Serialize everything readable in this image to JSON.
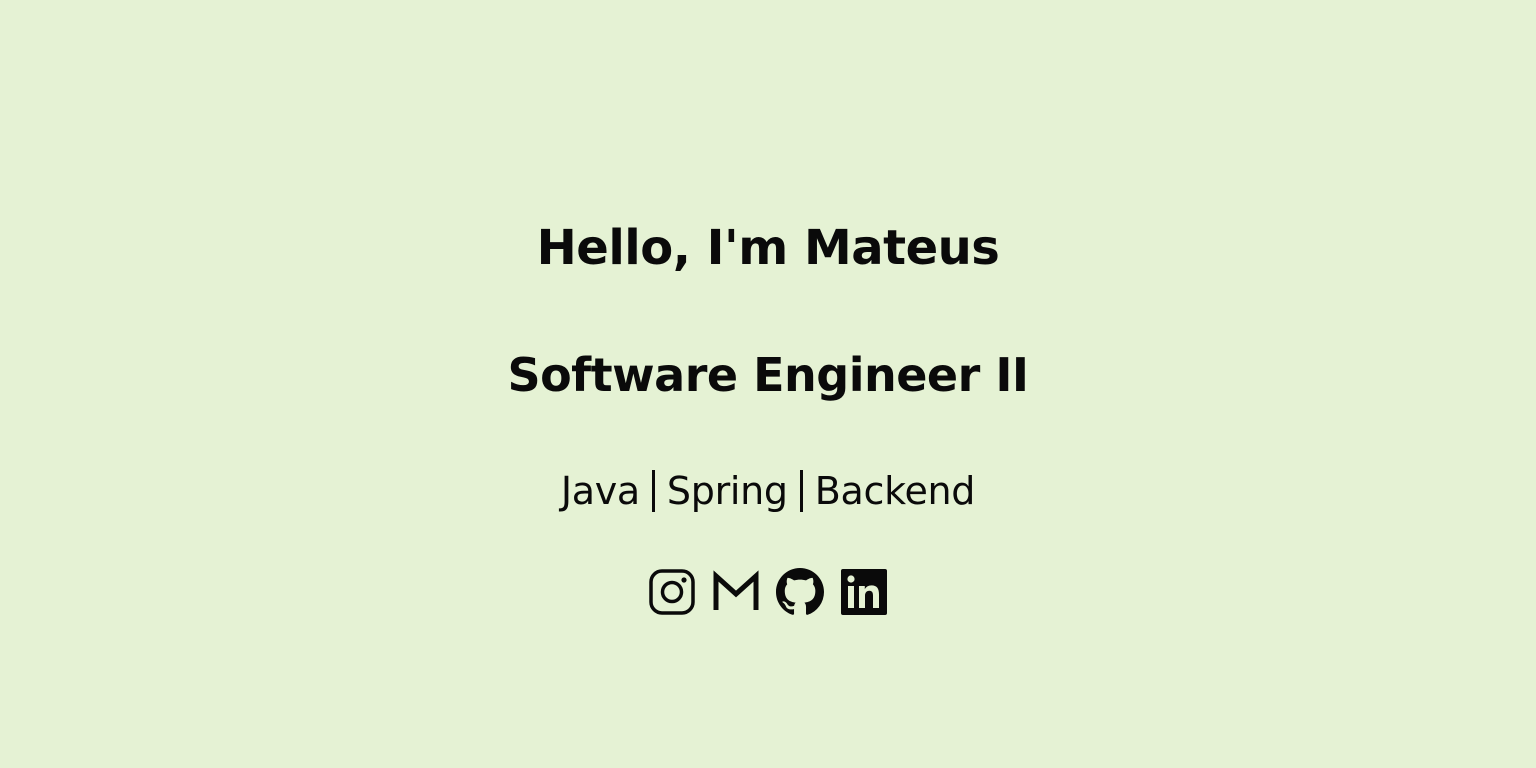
{
  "hero": {
    "title": "Hello, I'm Mateus",
    "subtitle": "Software Engineer II",
    "skills": [
      "Java",
      "Spring",
      "Backend"
    ]
  },
  "socials": [
    {
      "icon": "instagram-icon"
    },
    {
      "icon": "gmail-icon"
    },
    {
      "icon": "github-icon"
    },
    {
      "icon": "linkedin-icon"
    }
  ],
  "colors": {
    "background": "#e5f2d4",
    "text": "#0a0a0a"
  }
}
